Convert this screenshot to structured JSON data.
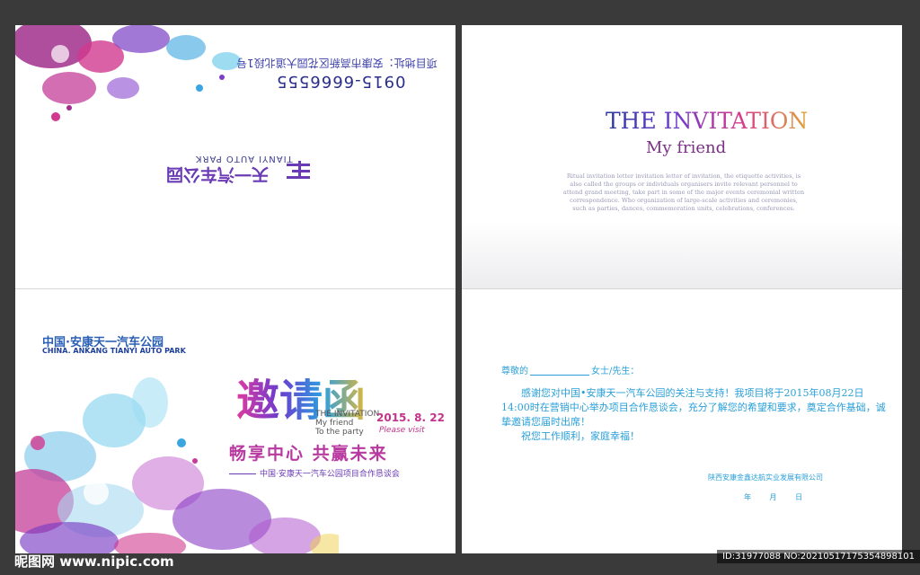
{
  "back_cover": {
    "address": "项目地址：安康市高新区花园大道北段1号",
    "phone": "0915-6666555",
    "logo_cn": "天一汽车公园",
    "logo_en": "TIANYI AUTO PARK"
  },
  "front_cover": {
    "company_cn": "中国·安康天一汽车公园",
    "company_en": "CHINA. ANKANG TIANYI AUTO PARK",
    "title": "邀请函",
    "invitation_lines": [
      "THE INVITATION",
      "My friend",
      "To the party"
    ],
    "date": "2015. 8. 22",
    "please_visit": "Please visit",
    "slogan": "畅享中心  共赢未来",
    "subtitle": "中国·安康天一汽车公园项目合作恳谈会"
  },
  "inside_top": {
    "title": "THE INVITATION",
    "subtitle": "My friend",
    "paragraph": "Ritual invitation letter invitation letter of invitation, the etiquette activities, is also called the groups or individuals organisers invite relevant personnel to attend grand meeting, take part in some of the major events ceremonial written correspondence. Who organization of large-scale activities and ceremonies, such as parties, dances, commemoration units, celebrations, conferences."
  },
  "letter": {
    "salutation_prefix": "尊敬的",
    "salutation_suffix": "女士/先生：",
    "body": "感谢您对中国•安康天一汽车公园的关注与支持！我项目将于2015年08月22日14:00时在营销中心举办项目合作恳谈会，充分了解您的希望和要求，奠定合作基础，诚挚邀请您届时出席！",
    "wishes": "祝您工作顺利，家庭幸福！",
    "signature": "陕西安康金鑫达航实业发展有限公司",
    "date_line": "年 月 日"
  },
  "watermark": {
    "site": "昵图网 www.nipic.com",
    "id_text": "ID:31977088 NO:20210517175354898101"
  },
  "colors": {
    "background": "#3a3a3a",
    "letter_text": "#2aa0d8",
    "accent_purple": "#6b3bd0",
    "accent_magenta": "#c2338b"
  }
}
